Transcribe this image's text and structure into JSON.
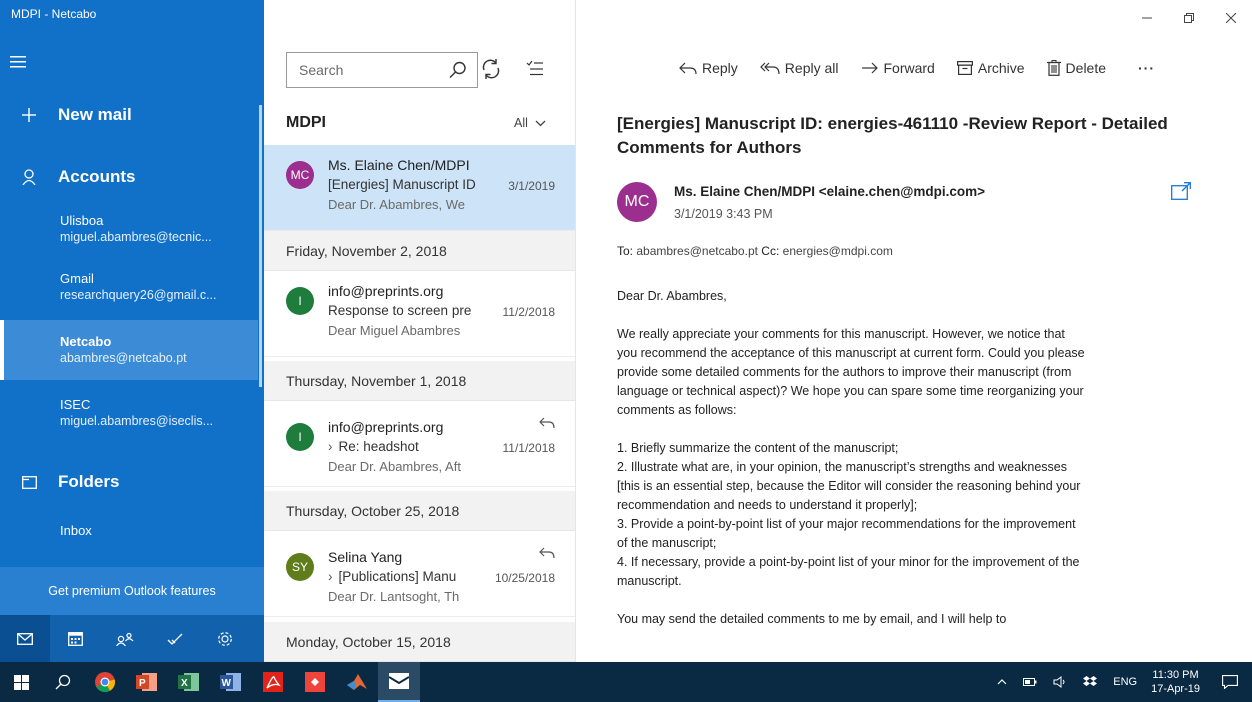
{
  "app": {
    "title": "MDPI - Netcabo"
  },
  "sidebar": {
    "new_mail": "New mail",
    "accounts_label": "Accounts",
    "accounts": [
      {
        "name": "Ulisboa",
        "email": "miguel.abambres@tecnic..."
      },
      {
        "name": "Gmail",
        "email": "researchquery26@gmail.c..."
      },
      {
        "name": "Netcabo",
        "email": "abambres@netcabo.pt"
      },
      {
        "name": "ISEC",
        "email": "miguel.abambres@iseclis..."
      }
    ],
    "folders_label": "Folders",
    "inbox": "Inbox",
    "premium": "Get premium Outlook features"
  },
  "list": {
    "search_placeholder": "Search",
    "folder": "MDPI",
    "filter": "All",
    "messages": [
      {
        "initials": "MC",
        "color": "#9b2e8e",
        "sender": "Ms. Elaine Chen/MDPI",
        "subject": "[Energies] Manuscript ID",
        "date": "3/1/2019",
        "preview": "Dear Dr. Abambres, We"
      },
      {
        "initials": "I",
        "color": "#1e7d3c",
        "sender": "info@preprints.org",
        "subject": "Response to screen pre",
        "date": "11/2/2018",
        "preview": "Dear Miguel Abambres"
      },
      {
        "initials": "I",
        "color": "#1e7d3c",
        "sender": "info@preprints.org",
        "subject": "Re: headshot",
        "date": "11/1/2018",
        "preview": "Dear Dr. Abambres, Aft"
      },
      {
        "initials": "SY",
        "color": "#5f7d1a",
        "sender": "Selina Yang",
        "subject": "[Publications] Manu",
        "date": "10/25/2018",
        "preview": "Dear Dr. Lantsoght, Th"
      }
    ],
    "date_headers": [
      "Friday, November 2, 2018",
      "Thursday, November 1, 2018",
      "Thursday, October 25, 2018",
      "Monday, October 15, 2018"
    ]
  },
  "reading": {
    "toolbar": {
      "reply": "Reply",
      "reply_all": "Reply all",
      "forward": "Forward",
      "archive": "Archive",
      "delete": "Delete",
      "more": "···"
    },
    "subject": "[Energies] Manuscript ID: energies-461110 -Review Report - Detailed Comments for Authors",
    "avatar": "MC",
    "from": "Ms. Elaine Chen/MDPI <elaine.chen@mdpi.com>",
    "time": "3/1/2019 3:43 PM",
    "to_label": "To:",
    "to": "abambres@netcabo.pt",
    "cc_label": "Cc:",
    "cc": "energies@mdpi.com",
    "body": {
      "greeting": "Dear Dr. Abambres,",
      "p1": "We really appreciate your comments for this manuscript. However, we notice that you recommend the acceptance of this manuscript at current form. Could you please provide some detailed comments for the authors to improve their manuscript (from language or technical aspect)? We hope you can spare some time reorganizing your comments as follows:",
      "item1": "1. Briefly summarize the content of the manuscript;",
      "item2": "2. Illustrate what are, in your opinion, the manuscript’s strengths and weaknesses [this is an essential step, because the Editor will consider the reasoning behind your recommendation and needs to understand it properly];",
      "item3": "3. Provide a point-by-point list of your major recommendations for the improvement of the manuscript;",
      "item4": "4. If necessary, provide a point-by-point list of your minor for the improvement of the manuscript.",
      "p2": "You may send the detailed comments to me by email, and I will help to"
    }
  },
  "taskbar": {
    "lang": "ENG",
    "time": "11:30 PM",
    "date": "17-Apr-19"
  }
}
